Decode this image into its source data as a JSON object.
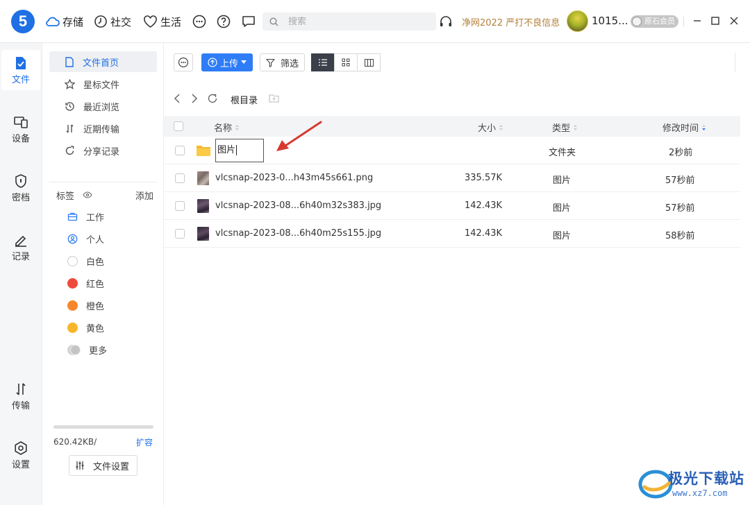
{
  "app": {
    "logo_text": "5"
  },
  "topbar": {
    "tabs": [
      {
        "label": "存储",
        "icon": "cloud-icon"
      },
      {
        "label": "社交",
        "icon": "clock-icon"
      },
      {
        "label": "生活",
        "icon": "heart-icon"
      }
    ],
    "search_placeholder": "搜索",
    "promo": "净网2022 严打不良信息",
    "username": "1015...",
    "vip_label": "原石会员"
  },
  "rail": [
    {
      "label": "文件",
      "icon": "file-icon",
      "active": true
    },
    {
      "label": "设备",
      "icon": "device-icon"
    },
    {
      "label": "密档",
      "icon": "shield-icon"
    },
    {
      "label": "记录",
      "icon": "pencil-icon"
    },
    {
      "label": "传输",
      "icon": "transfer-icon"
    },
    {
      "label": "设置",
      "icon": "settings-icon"
    }
  ],
  "side": {
    "items": [
      {
        "label": "文件首页",
        "icon": "document-icon",
        "active": true
      },
      {
        "label": "星标文件",
        "icon": "star-icon"
      },
      {
        "label": "最近浏览",
        "icon": "history-icon"
      },
      {
        "label": "近期传输",
        "icon": "transfer-icon"
      },
      {
        "label": "分享记录",
        "icon": "share-icon"
      }
    ],
    "tags_title": "标签",
    "tags_add": "添加",
    "tags": [
      {
        "label": "工作",
        "color": "#2e7cf6",
        "icon": "briefcase-icon"
      },
      {
        "label": "个人",
        "color": "#2e7cf6",
        "icon": "person-icon"
      },
      {
        "label": "白色",
        "color": "#ffffff"
      },
      {
        "label": "红色",
        "color": "#f04a3c"
      },
      {
        "label": "橙色",
        "color": "#f6862b"
      },
      {
        "label": "黄色",
        "color": "#f7b52b"
      },
      {
        "label": "更多",
        "color": "#cccccc"
      }
    ],
    "quota_used": "620.42KB/",
    "expand_label": "扩容",
    "file_settings": "文件设置"
  },
  "toolbar": {
    "upload": "上传",
    "filter": "筛选"
  },
  "breadcrumb": {
    "root": "根目录"
  },
  "table": {
    "headers": {
      "name": "名称",
      "size": "大小",
      "type": "类型",
      "modified": "修改时间"
    },
    "rows": [
      {
        "name": "图片",
        "size": "",
        "type": "文件夹",
        "modified": "2秒前",
        "kind": "folder",
        "renaming": true
      },
      {
        "name": "vlcsnap-2023-0...h43m45s661.png",
        "size": "335.57K",
        "type": "图片",
        "modified": "57秒前",
        "kind": "image"
      },
      {
        "name": "vlcsnap-2023-08...6h40m32s383.jpg",
        "size": "142.43K",
        "type": "图片",
        "modified": "57秒前",
        "kind": "image"
      },
      {
        "name": "vlcsnap-2023-08...6h40m25s155.jpg",
        "size": "142.43K",
        "type": "图片",
        "modified": "58秒前",
        "kind": "image"
      }
    ]
  },
  "watermark": {
    "text": "极光下载站",
    "url": "www.xz7.com"
  },
  "colors": {
    "accent": "#1f6fe5",
    "upload": "#2e7cf6",
    "promo": "#b4803a",
    "arrow": "#d63a2f"
  }
}
